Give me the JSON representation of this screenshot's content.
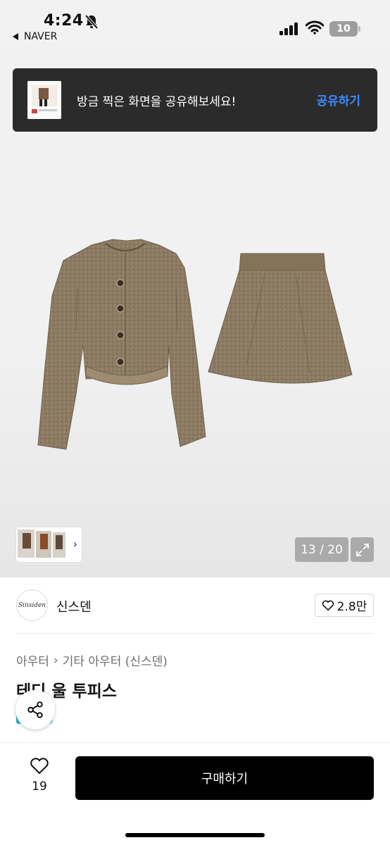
{
  "status_bar": {
    "time": "4:24",
    "back_app": "NAVER",
    "battery": "10"
  },
  "share_banner": {
    "text": "방금 찍은 화면을 공유해보세요!",
    "action": "공유하기"
  },
  "gallery": {
    "counter": "13 / 20"
  },
  "seller": {
    "logo_text": "Sinsiden",
    "name": "신스덴",
    "likes": "2.8만"
  },
  "product": {
    "breadcrumb": [
      "아우터",
      "기타 아우터 (신스덴)"
    ],
    "title": "테디 울 투피스"
  },
  "bottom_bar": {
    "wish_count": "19",
    "buy_label": "구매하기"
  },
  "colors": {
    "accent_link": "#3d8bff",
    "tweed": "#8b7a62",
    "buy_button": "#000000"
  },
  "icons": [
    "bell-slash-icon",
    "cellular-signal-icon",
    "wifi-icon",
    "battery-icon",
    "chevron-right-icon",
    "expand-icon",
    "heart-icon",
    "share-icon"
  ]
}
